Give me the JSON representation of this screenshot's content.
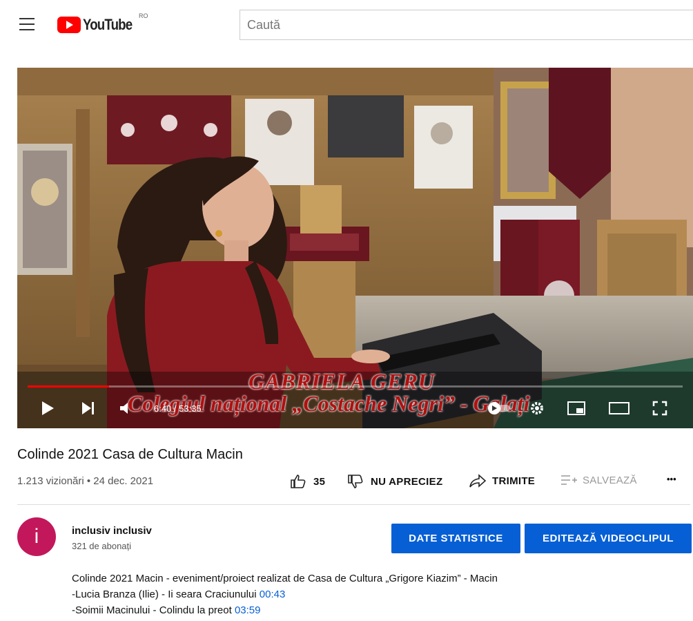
{
  "header": {
    "logo_text": "YouTube",
    "country_code": "RO",
    "search_placeholder": "Caută"
  },
  "player": {
    "time_display": "6:40 / 53:35",
    "progress_fraction": 0.124,
    "overlay_line1": "GABRIELA GERU",
    "overlay_line2": "Colegiul național „Costache Negri” - Galați"
  },
  "video": {
    "title": "Colinde 2021 Casa de Cultura Macin",
    "views_date": "1.213 vizionări • 24 dec. 2021",
    "like_count": "35",
    "dislike_label": "NU APRECIEZ",
    "share_label": "TRIMITE",
    "save_label": "SALVEAZĂ",
    "more_label": "•••"
  },
  "channel": {
    "avatar_letter": "i",
    "avatar_color": "#c2185b",
    "name": "inclusiv inclusiv",
    "subscribers": "321 de abonați",
    "stats_button": "DATE STATISTICE",
    "edit_button": "EDITEAZĂ VIDEOCLIPUL"
  },
  "description": {
    "line1": "Colinde 2021 Macin - eveniment/proiect realizat de Casa de Cultura „Grigore Kiazim” - Macin",
    "line2_text": "-Lucia Branza (Ilie) - Ii seara Craciunului ",
    "line2_ts": "00:43",
    "line3_text": "-Soimii Macinului - Colindu la preot ",
    "line3_ts": "03:59"
  },
  "colors": {
    "accent": "#065fd4",
    "brand": "#ff0000"
  }
}
